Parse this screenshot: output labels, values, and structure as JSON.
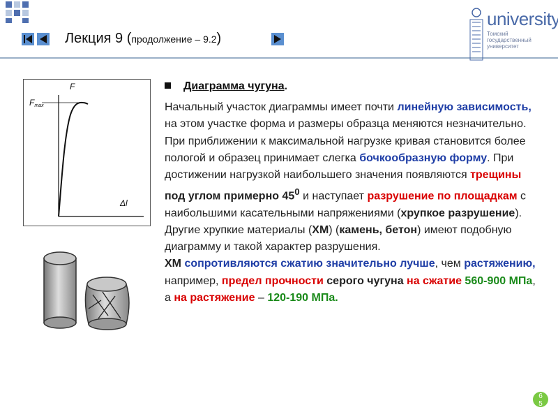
{
  "header": {
    "title_main": "Лекция 9 (",
    "title_small": "продолжение – 9.2",
    "title_close": ")",
    "logo_text": "university",
    "logo_subtitle": "Томский государственный университет"
  },
  "colors": {
    "accent_blue": "#1f3ea6",
    "accent_red": "#d90000",
    "accent_green": "#1a8a1a",
    "page_badge": "#7ac943",
    "square_blue": "#4f6fb0",
    "square_light": "#b8c8e0"
  },
  "graph": {
    "label_f": "F",
    "label_fmax_main": "F",
    "label_fmax_sub": "max",
    "label_dl": "Δl"
  },
  "content": {
    "heading": "Диаграмма чугуна",
    "heading_dot": ".",
    "p1_a": "Начальный участок диаграммы имеет почти ",
    "p1_b": "линейную зависимость,",
    "p1_c": " на этом участке форма и размеры образца меняются незначительно. При приближении к максимальной нагрузке кривая становится более пологой и образец принимает слегка ",
    "p1_d": "бочкообразную форму",
    "p1_e": ". При достижении нагрузкой наибольшего значения появляются ",
    "p1_f": "трещины",
    "p1_g": " под углом примерно 45",
    "p1_sup": "0",
    "p1_h": " и наступает ",
    "p1_i": "разрушение по площадкам",
    "p1_j": " с наибольшими касательными напряжениями (",
    "p1_k": "хрупкое разрушение",
    "p1_l": "). Другие хрупкие материалы (",
    "p1_m": "ХМ",
    "p1_n": ") (",
    "p1_o": "камень, бетон",
    "p1_p": ") имеют подобную диаграмму и такой характер разрушения.",
    "p2_a": "ХМ",
    "p2_b": " сопротивляются сжатию значительно лучше",
    "p2_c": ", чем ",
    "p2_d": "растяжению,",
    "p2_e": " например, ",
    "p2_f": "предел прочности",
    "p2_g": " серого чугуна ",
    "p2_h": "на сжатие",
    "p2_i": " 560-900 МПа",
    "p2_j": ", а ",
    "p2_k": "на растяжение",
    "p2_l": " – ",
    "p2_m": "120-190 МПа."
  },
  "page_number": {
    "d1": "6",
    "d2": "5"
  }
}
